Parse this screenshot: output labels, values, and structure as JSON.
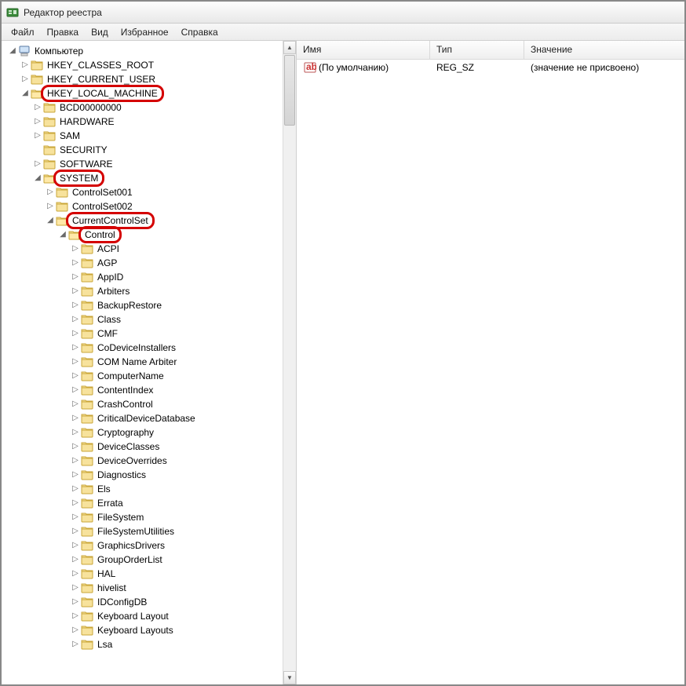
{
  "window": {
    "title": "Редактор реестра"
  },
  "menu": {
    "file": "Файл",
    "edit": "Правка",
    "view": "Вид",
    "favorites": "Избранное",
    "help": "Справка"
  },
  "tree": {
    "root": "Компьютер",
    "hkcr": "HKEY_CLASSES_ROOT",
    "hkcu": "HKEY_CURRENT_USER",
    "hklm": "HKEY_LOCAL_MACHINE",
    "hklm_children": {
      "bcd": "BCD00000000",
      "hardware": "HARDWARE",
      "sam": "SAM",
      "security": "SECURITY",
      "software": "SOFTWARE",
      "system": "SYSTEM"
    },
    "system_children": {
      "cs001": "ControlSet001",
      "cs002": "ControlSet002",
      "ccs": "CurrentControlSet"
    },
    "ccs_children": {
      "control": "Control"
    },
    "control_children": [
      "ACPI",
      "AGP",
      "AppID",
      "Arbiters",
      "BackupRestore",
      "Class",
      "CMF",
      "CoDeviceInstallers",
      "COM Name Arbiter",
      "ComputerName",
      "ContentIndex",
      "CrashControl",
      "CriticalDeviceDatabase",
      "Cryptography",
      "DeviceClasses",
      "DeviceOverrides",
      "Diagnostics",
      "Els",
      "Errata",
      "FileSystem",
      "FileSystemUtilities",
      "GraphicsDrivers",
      "GroupOrderList",
      "HAL",
      "hivelist",
      "IDConfigDB",
      "Keyboard Layout",
      "Keyboard Layouts",
      "Lsa"
    ]
  },
  "list": {
    "columns": {
      "name": "Имя",
      "type": "Тип",
      "value": "Значение"
    },
    "rows": [
      {
        "name": "(По умолчанию)",
        "type": "REG_SZ",
        "value": "(значение не присвоено)"
      }
    ]
  }
}
